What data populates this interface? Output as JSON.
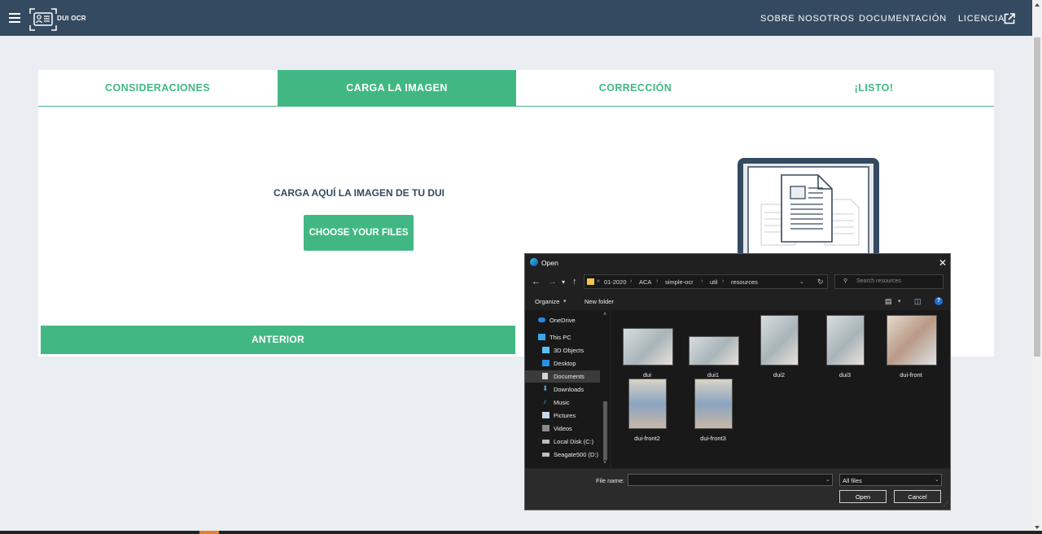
{
  "header": {
    "logo_text": "DUI OCR",
    "nav": [
      "SOBRE NOSOTROS",
      "DOCUMENTACIÓN",
      "LICENCIA"
    ]
  },
  "tabs": [
    "CONSIDERACIONES",
    "CARGA LA IMAGEN",
    "CORRECCIÓN",
    "¡LISTO!"
  ],
  "active_tab": 1,
  "upload": {
    "title": "CARGA AQUÍ LA IMAGEN DE TU DUI",
    "choose_label": "CHOOSE YOUR FILES",
    "prev_label": "ANTERIOR"
  },
  "colors": {
    "header_bg": "#344a60",
    "accent": "#41b883",
    "page_bg": "#eaeef2"
  },
  "dialog": {
    "title": "Open",
    "path": [
      "01-2020",
      "ACA",
      "simple-ocr",
      "util",
      "resources"
    ],
    "search_placeholder": "Search resources",
    "toolbar": {
      "organize": "Organize",
      "new_folder": "New folder"
    },
    "nav_items": [
      {
        "label": "OneDrive",
        "icon": "cloud-icon"
      },
      {
        "label": "This PC",
        "icon": "computer-icon"
      },
      {
        "label": "3D Objects",
        "icon": "cube-icon"
      },
      {
        "label": "Desktop",
        "icon": "desktop-icon"
      },
      {
        "label": "Documents",
        "icon": "document-icon"
      },
      {
        "label": "Downloads",
        "icon": "download-icon"
      },
      {
        "label": "Music",
        "icon": "music-icon"
      },
      {
        "label": "Pictures",
        "icon": "pictures-icon"
      },
      {
        "label": "Videos",
        "icon": "video-icon"
      },
      {
        "label": "Local Disk (C:)",
        "icon": "drive-icon"
      },
      {
        "label": "Seagate500 (D:)",
        "icon": "drive-icon"
      }
    ],
    "selected_nav": "Documents",
    "files": [
      "dui",
      "dui1",
      "dui2",
      "dui3",
      "dui-front",
      "dui-front2",
      "dui-front3"
    ],
    "file_name_label": "File name:",
    "file_name_value": "",
    "file_type": "All files",
    "open_label": "Open",
    "cancel_label": "Cancel"
  }
}
